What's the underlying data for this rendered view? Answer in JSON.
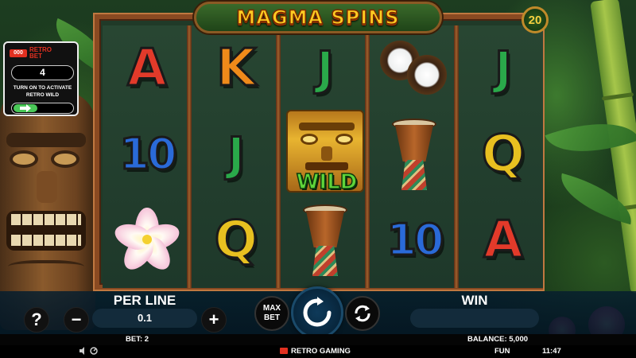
{
  "game": {
    "title": "MAGMA SPINS",
    "lines": "20",
    "colors": {
      "frame": "#8a4a22",
      "title": "#ffcc22",
      "wild": "#5ed43a",
      "panel_bg": "#061e2e"
    }
  },
  "retro_bet": {
    "logo_box": "000",
    "logo_text": "RETRO BET",
    "count": "4",
    "hint": "TURN ON TO ACTIVATE RETRO WILD",
    "toggle_icon": "arrow-right-icon"
  },
  "reels": [
    [
      "A",
      "10",
      "flower"
    ],
    [
      "K",
      "J",
      "Q"
    ],
    [
      "J",
      "wild",
      "drum"
    ],
    [
      "coconut",
      "drum",
      "10"
    ],
    [
      "J",
      "Q",
      "A"
    ]
  ],
  "wild_label": "WILD",
  "controls": {
    "help_label": "?",
    "minus_label": "−",
    "plus_label": "+",
    "per_line_label": "PER LINE",
    "per_line_value": "0.1",
    "max_bet_label": "MAX BET",
    "win_label": "WIN",
    "win_value": ""
  },
  "status": {
    "bet": "BET: 2",
    "balance": "BALANCE: 5,000",
    "mode": "FUN",
    "time": "11:47",
    "brand": "RETRO GAMING"
  }
}
